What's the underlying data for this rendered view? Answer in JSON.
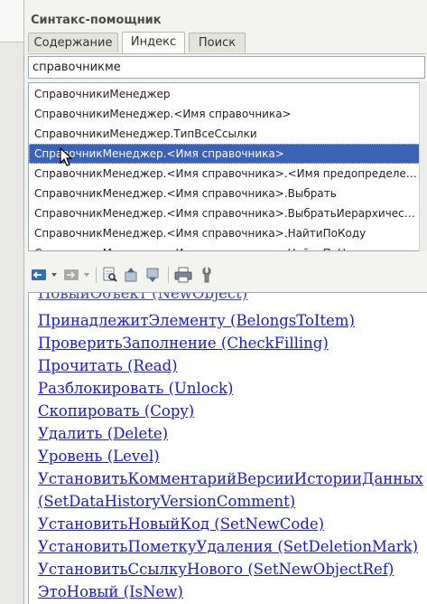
{
  "panel": {
    "title": "Синтакс-помощник",
    "tabs": [
      {
        "label": "Содержание",
        "active": false
      },
      {
        "label": "Индекс",
        "active": true
      },
      {
        "label": "Поиск",
        "active": false
      }
    ]
  },
  "search": {
    "value": "справочникме"
  },
  "results": {
    "items": [
      {
        "label": "СправочникиМенеджер",
        "selected": false
      },
      {
        "label": "СправочникиМенеджер.<Имя справочника>",
        "selected": false
      },
      {
        "label": "СправочникиМенеджер.ТипВсеСсылки",
        "selected": false
      },
      {
        "label": "СправочникМенеджер.<Имя справочника>",
        "selected": true
      },
      {
        "label": "СправочникМенеджер.<Имя справочника>.<Имя предопределе…",
        "selected": false
      },
      {
        "label": "СправочникМенеджер.<Имя справочника>.Выбрать",
        "selected": false
      },
      {
        "label": "СправочникМенеджер.<Имя справочника>.ВыбратьИерархичес…",
        "selected": false
      },
      {
        "label": "СправочникМенеджер.<Имя справочника>.НайтиПоКоду",
        "selected": false
      },
      {
        "label": "СправочникМенеджер.<Имя справочника>.НайтиПоН…",
        "selected": false
      }
    ]
  },
  "toolbar": {
    "icons": [
      "back-icon",
      "forward-icon",
      "find-in-page-icon",
      "previous-topic-icon",
      "next-topic-icon",
      "print-icon",
      "settings-icon"
    ]
  },
  "content": {
    "partial_top": "НовыйОбъект (NewObject)",
    "links": [
      "ПринадлежитЭлементу (BelongsToItem)",
      "ПроверитьЗаполнение (CheckFilling)",
      "Прочитать (Read)",
      "Разблокировать (Unlock)",
      "Скопировать (Copy)",
      "Удалить (Delete)",
      "Уровень (Level)",
      "УстановитьКомментарийВерсииИсторииДанных",
      "(SetDataHistoryVersionComment)",
      "УстановитьНовыйКод (SetNewCode)",
      "УстановитьПометкуУдаления (SetDeletionMark)",
      "УстановитьСсылкуНового (SetNewObjectRef)",
      "ЭтоНовый (IsNew)"
    ]
  },
  "colors": {
    "selection": "#3b62b4",
    "link": "#1a1ad0"
  }
}
